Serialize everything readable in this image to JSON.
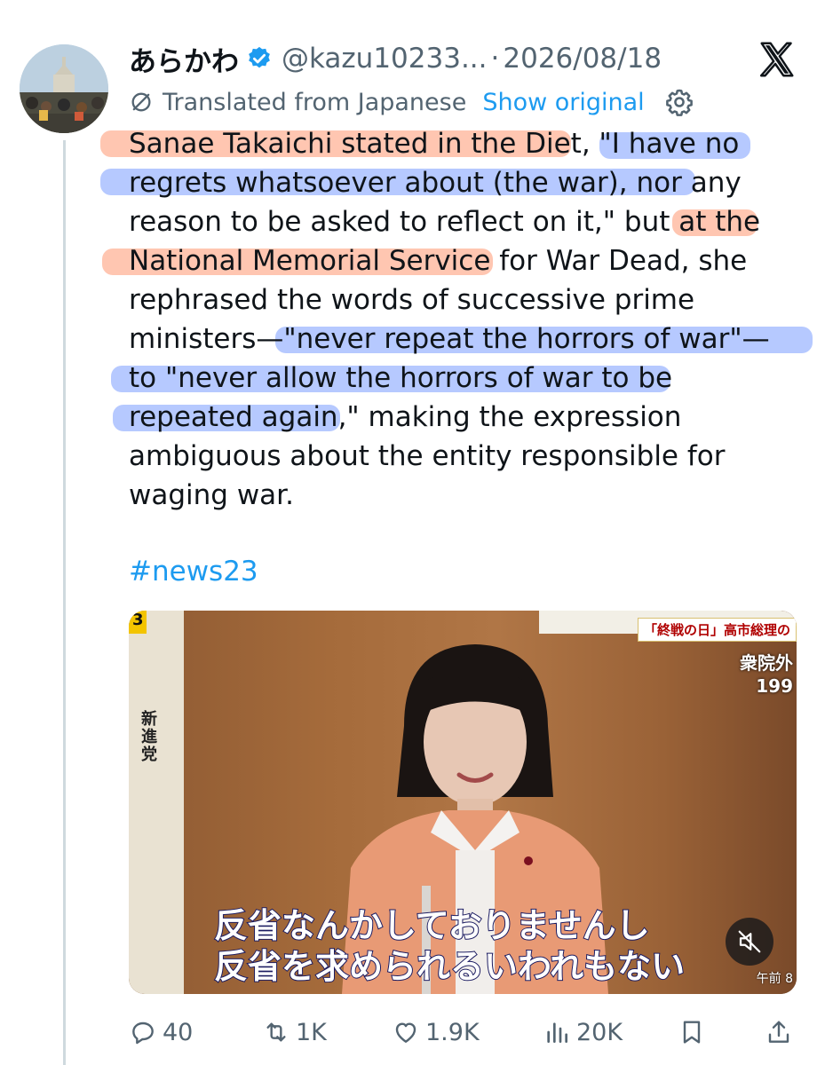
{
  "header": {
    "display_name": "あらかわ",
    "handle": "@kazu10233...",
    "separator": "·",
    "date": "2026/08/18"
  },
  "translation": {
    "label": "Translated from Japanese",
    "show_original": "Show original"
  },
  "tweet": {
    "lines": [
      "Sanae Takaichi stated in the Diet, \"I have no",
      "regrets whatsoever about (the war), nor any",
      "reason to be asked to reflect on it,\" but at the",
      "National Memorial Service for War Dead, she",
      "rephrased the words of successive prime",
      "ministers—\"never repeat the horrors of war\"—",
      "to \"never allow the horrors of war to be",
      "repeated again,\" making the expression",
      "ambiguous about the entity responsible for",
      "waging war."
    ],
    "hashtag": "#news23"
  },
  "media": {
    "caption_line1": "反省なんかしておりませんし",
    "caption_line2": "反省を求められるいわれもない",
    "topic_banner": "「終戦の日」高市総理の",
    "side_label": "新進党",
    "right_info_line1": "衆院外",
    "right_info_line2": "199",
    "corner_number": "3",
    "time_text": "午前 8"
  },
  "actions": {
    "replies": "40",
    "reposts": "1K",
    "likes": "1.9K",
    "views": "20K"
  },
  "colors": {
    "accent": "#1d9bf0",
    "secondary_text": "#536471",
    "highlight_orange": "#ffaa8c",
    "highlight_blue": "#8caaff"
  }
}
